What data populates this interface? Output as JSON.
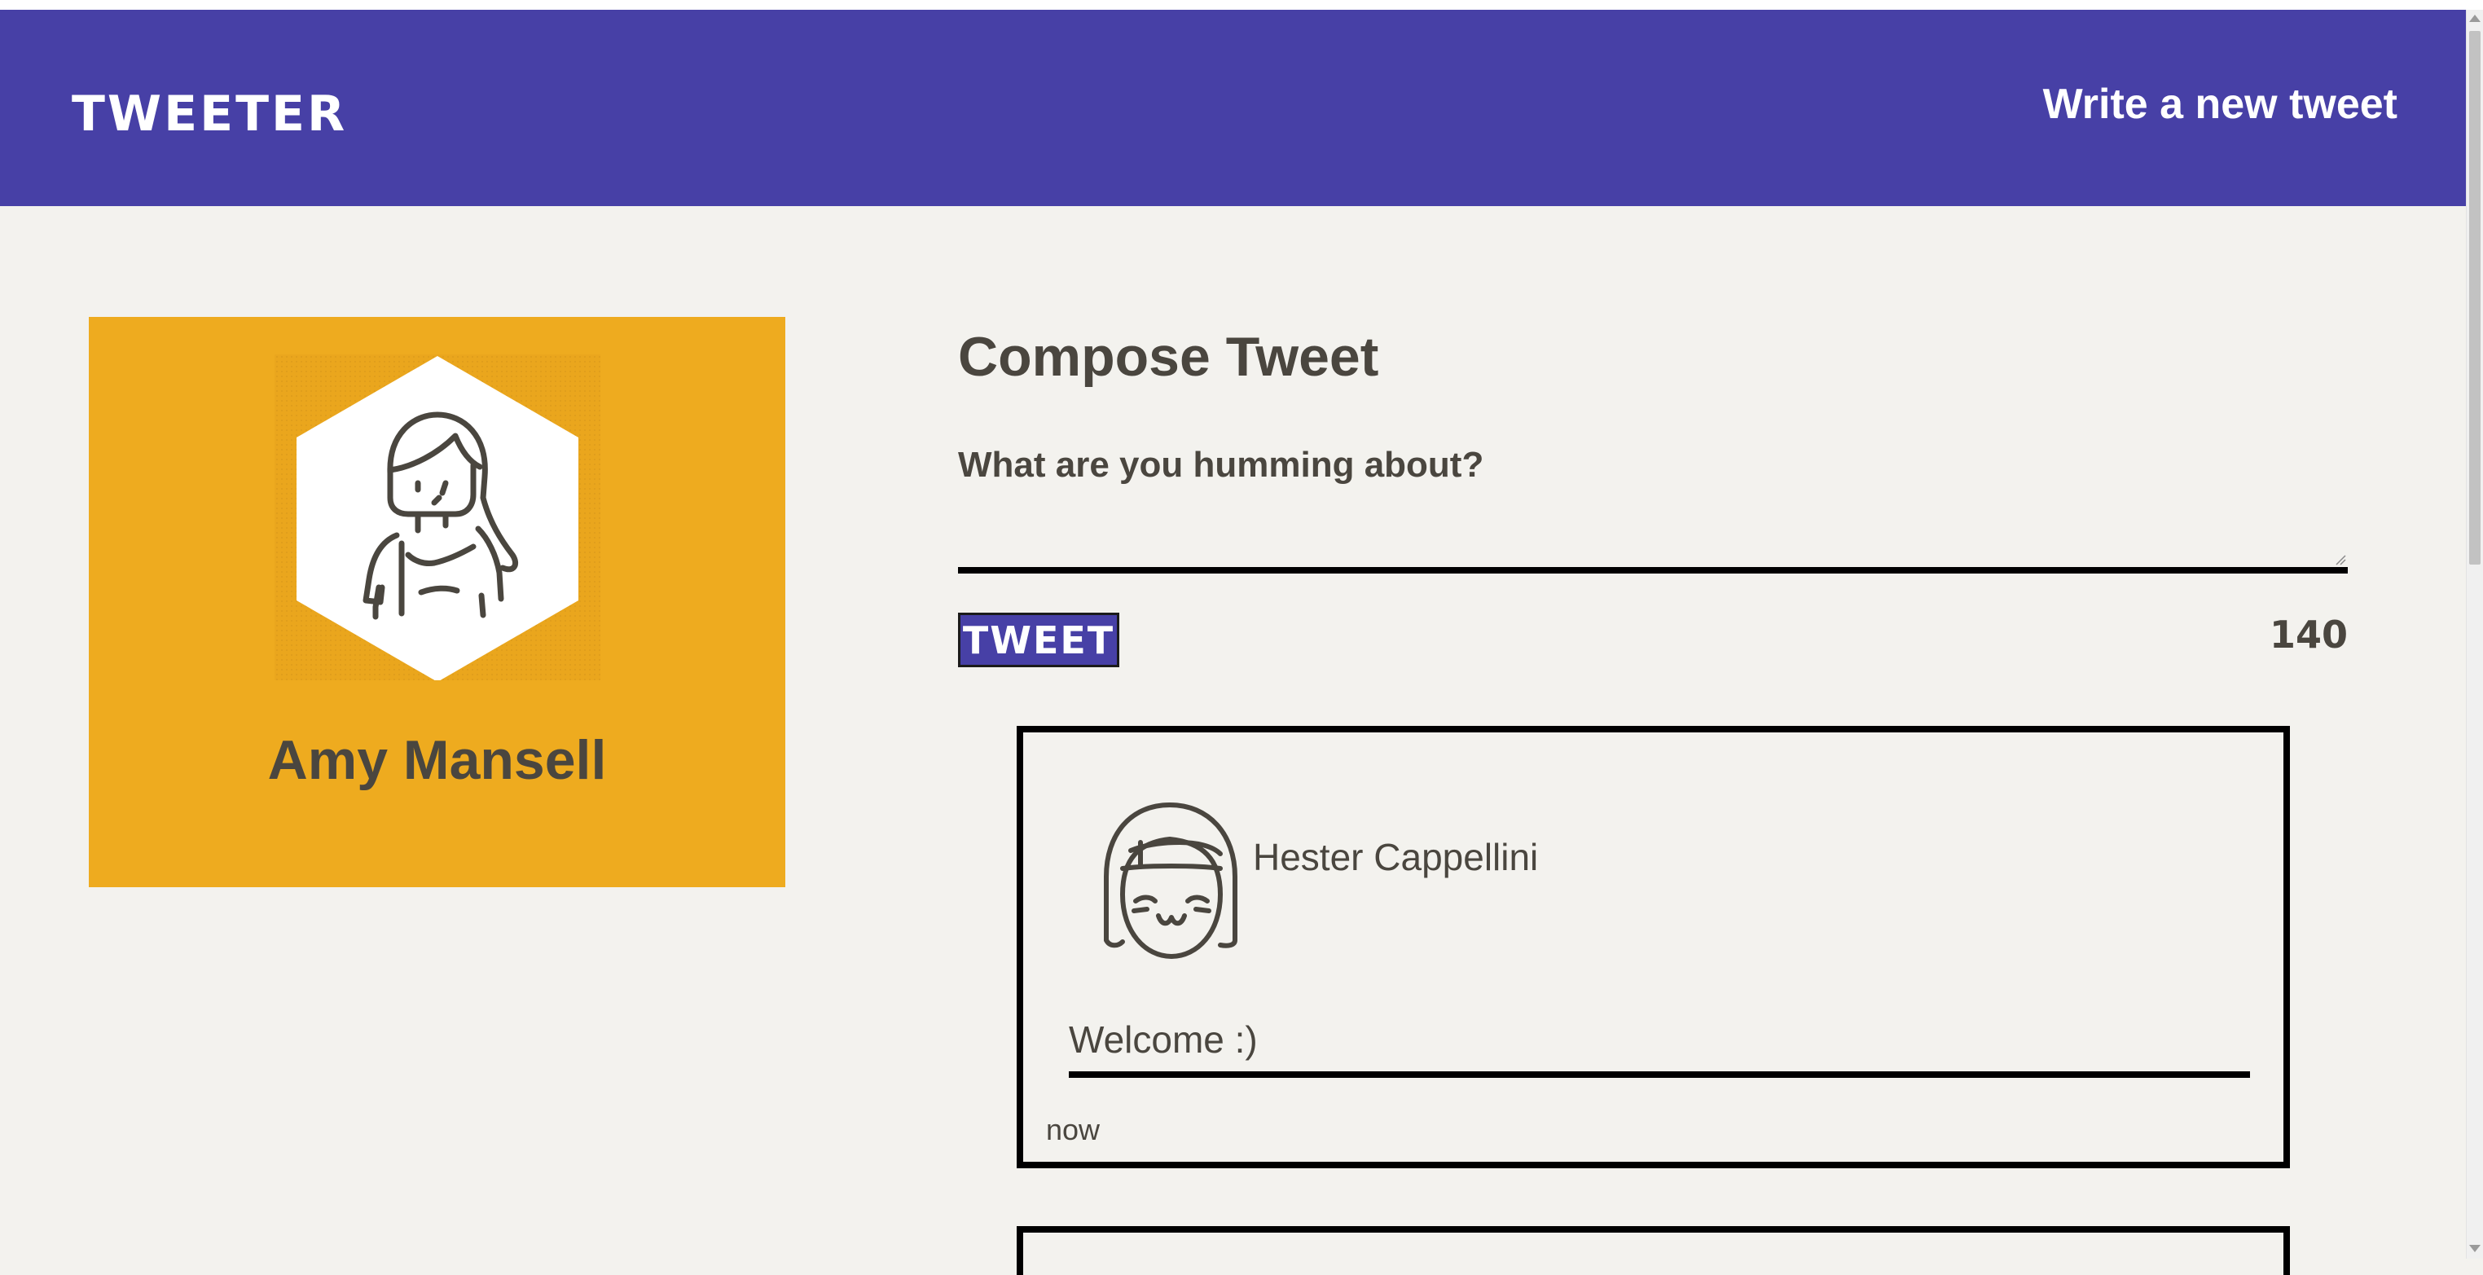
{
  "navbar": {
    "brand": "TWEETER",
    "write_link": "Write a new tweet",
    "background_color": "#4740a6"
  },
  "profile": {
    "name": "Amy Mansell",
    "card_color": "#eeab1f",
    "avatar_icon": "woman-avatar-hexagon-icon"
  },
  "compose": {
    "title": "Compose Tweet",
    "placeholder": "What are you humming about?",
    "value": "",
    "button_label": "TWEET",
    "counter": "140"
  },
  "tweets": [
    {
      "author": "Hester Cappellini",
      "avatar_icon": "girl-avatar-icon",
      "text": "Welcome :)",
      "time": "now"
    }
  ]
}
